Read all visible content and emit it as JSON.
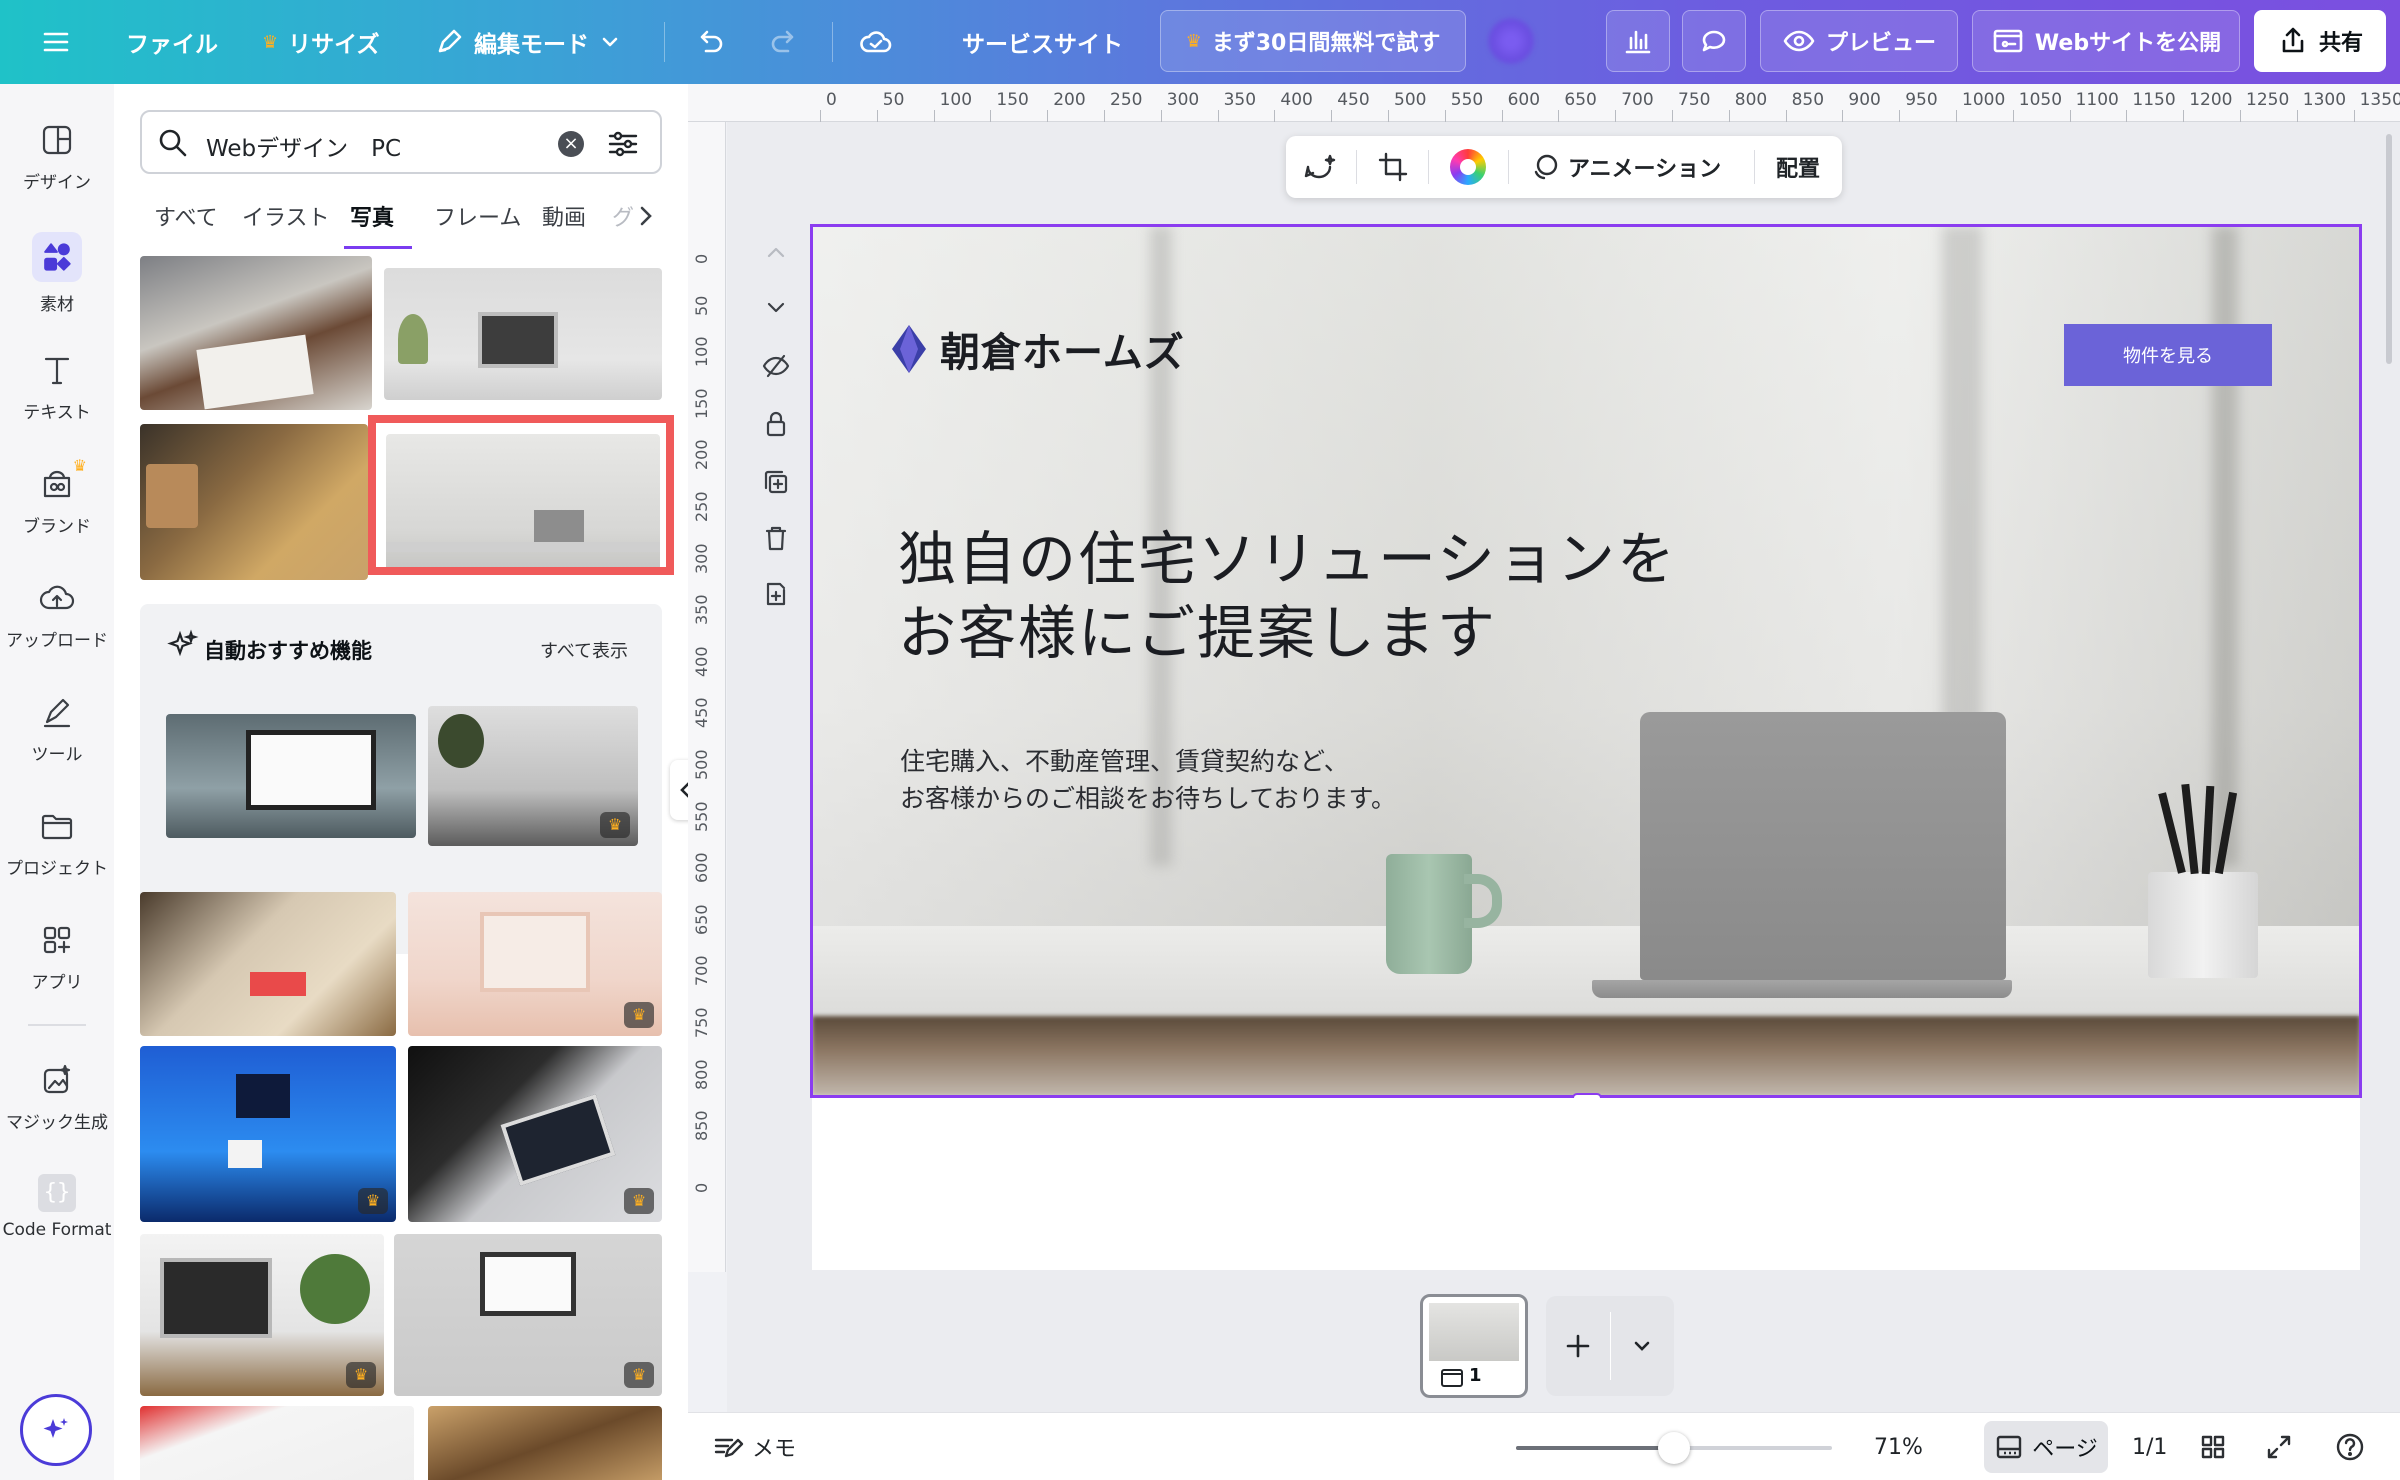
{
  "topbar": {
    "file": "ファイル",
    "resize": "リサイズ",
    "edit_mode": "編集モード",
    "service_site": "サービスサイト",
    "trial": "まず30日間無料で試す",
    "preview": "プレビュー",
    "publish": "Webサイトを公開",
    "share": "共有"
  },
  "rail": {
    "items": [
      {
        "label": "デザイン",
        "icon": "design-icon"
      },
      {
        "label": "素材",
        "icon": "elements-icon"
      },
      {
        "label": "テキスト",
        "icon": "text-icon"
      },
      {
        "label": "ブランド",
        "icon": "brand-icon"
      },
      {
        "label": "アップロード",
        "icon": "upload-icon"
      },
      {
        "label": "ツール",
        "icon": "tools-icon"
      },
      {
        "label": "プロジェクト",
        "icon": "folder-icon"
      },
      {
        "label": "アプリ",
        "icon": "apps-icon"
      },
      {
        "label": "マジック生成",
        "icon": "magic-generate-icon"
      },
      {
        "label": "Code Format",
        "icon": "code-format-icon"
      }
    ]
  },
  "panel": {
    "search_value": "Webデザイン　PC",
    "tabs": [
      "すべて",
      "イラスト",
      "写真",
      "フレーム",
      "動画",
      "グ"
    ],
    "active_tab": "写真",
    "auto_title": "自動おすすめ機能",
    "auto_all": "すべて表示"
  },
  "ruler": {
    "h": [
      "0",
      "50",
      "100",
      "150",
      "200",
      "250",
      "300",
      "350",
      "400",
      "450",
      "500",
      "550",
      "600",
      "650",
      "700",
      "750",
      "800",
      "850",
      "900",
      "950",
      "1000",
      "1050",
      "1100",
      "1150",
      "1200",
      "1250",
      "1300",
      "1350"
    ],
    "v": [
      "0",
      "50",
      "100",
      "150",
      "200",
      "250",
      "300",
      "350",
      "400",
      "450",
      "500",
      "550",
      "600",
      "650",
      "700",
      "750",
      "800",
      "850",
      "0"
    ]
  },
  "floating_toolbar": {
    "animation": "アニメーション",
    "position": "配置"
  },
  "page": {
    "brand_name": "朝倉ホームズ",
    "cta": "物件を見る",
    "hero_line1": "独自の住宅ソリューションを",
    "hero_line2": "お客様にご提案します",
    "sub_line1": "住宅購入、不動産管理、賃貸契約など、",
    "sub_line2": "お客様からのご相談をお待ちしております。"
  },
  "thumbnail_strip": {
    "page_number": "1"
  },
  "bottombar": {
    "memo": "メモ",
    "zoom": "71%",
    "page_btn": "ページ",
    "page_count": "1/1",
    "zoom_fraction": 0.5
  },
  "colors": {
    "accent": "#8b3cf0",
    "cta": "#6b63d8",
    "highlight_box": "#f05a5a"
  }
}
